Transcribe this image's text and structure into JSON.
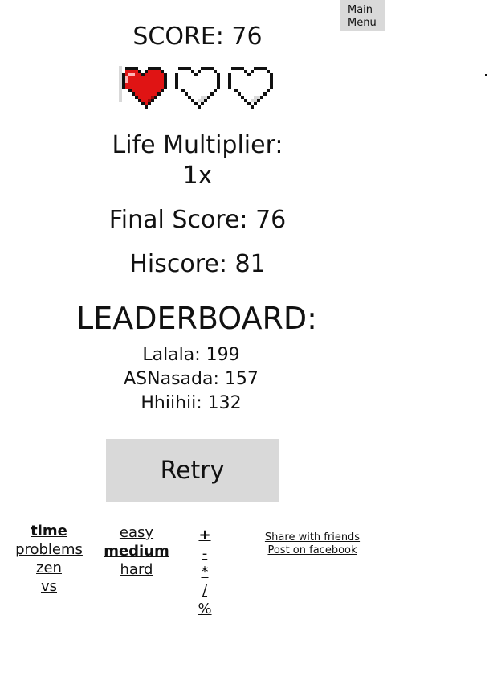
{
  "main_menu": {
    "line1": "Main",
    "line2": "Menu"
  },
  "score": {
    "label": "SCORE: 76"
  },
  "lives": {
    "total": 3,
    "remaining": 1,
    "full_color": "#e01414",
    "empty_color": "#ffffff",
    "icons": [
      "heart-full-icon",
      "heart-empty-icon",
      "heart-empty-icon"
    ]
  },
  "results": {
    "life_multiplier_label": "Life Multiplier:",
    "life_multiplier_value": "1x",
    "final_score": "Final Score: 76",
    "hiscore": "Hiscore: 81"
  },
  "leaderboard": {
    "title": "LEADERBOARD:",
    "entries": [
      "Lalala: 199",
      "ASNasada: 157",
      "Hhiihii: 132"
    ]
  },
  "retry": {
    "label": "Retry"
  },
  "modes": {
    "items": [
      "time",
      "problems",
      "zen",
      "vs"
    ],
    "selected": "time"
  },
  "difficulty": {
    "items": [
      "easy",
      "medium",
      "hard"
    ],
    "selected": "medium"
  },
  "operators": {
    "items": [
      "+",
      "-",
      "*",
      "/",
      "%"
    ],
    "selected": "+"
  },
  "share": {
    "friends": "Share with friends",
    "facebook": "Post on facebook"
  },
  "colors": {
    "button_bg": "#d9d9d9",
    "text": "#111111",
    "heart_shadow": "#d9d9d9"
  }
}
